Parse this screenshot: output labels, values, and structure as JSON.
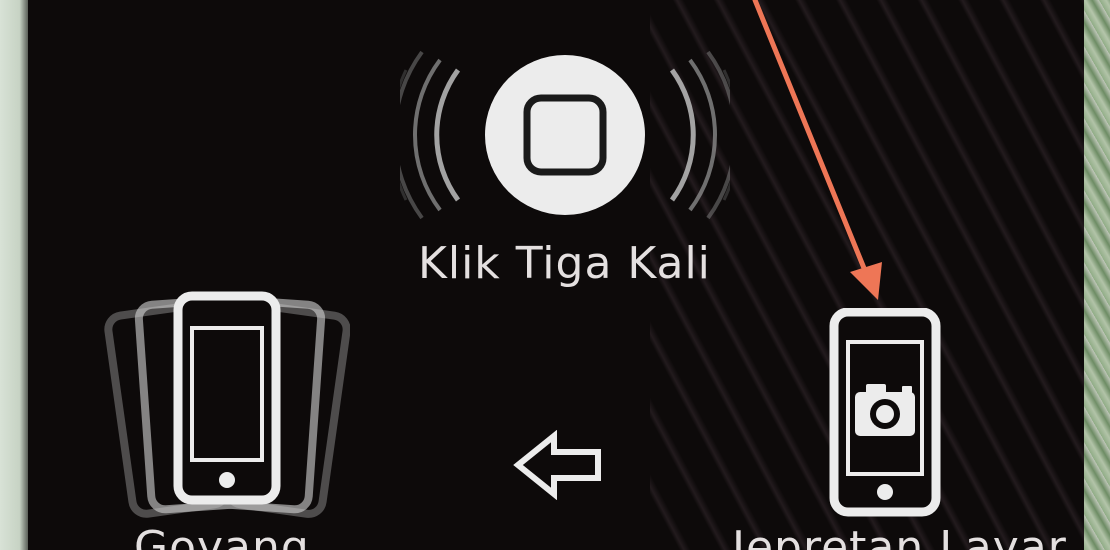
{
  "options": {
    "triple_click": {
      "label": "Klik Tiga Kali",
      "icon": "home-button-icon"
    },
    "shake": {
      "label": "Goyang",
      "icon": "shaking-phone-icon"
    },
    "screenshot": {
      "label": "Jepretan Layar",
      "icon": "camera-phone-icon"
    }
  },
  "colors": {
    "background": "#0d0a0a",
    "icon_white": "#e8e8e8",
    "pointer_arrow": "#ee7656"
  }
}
